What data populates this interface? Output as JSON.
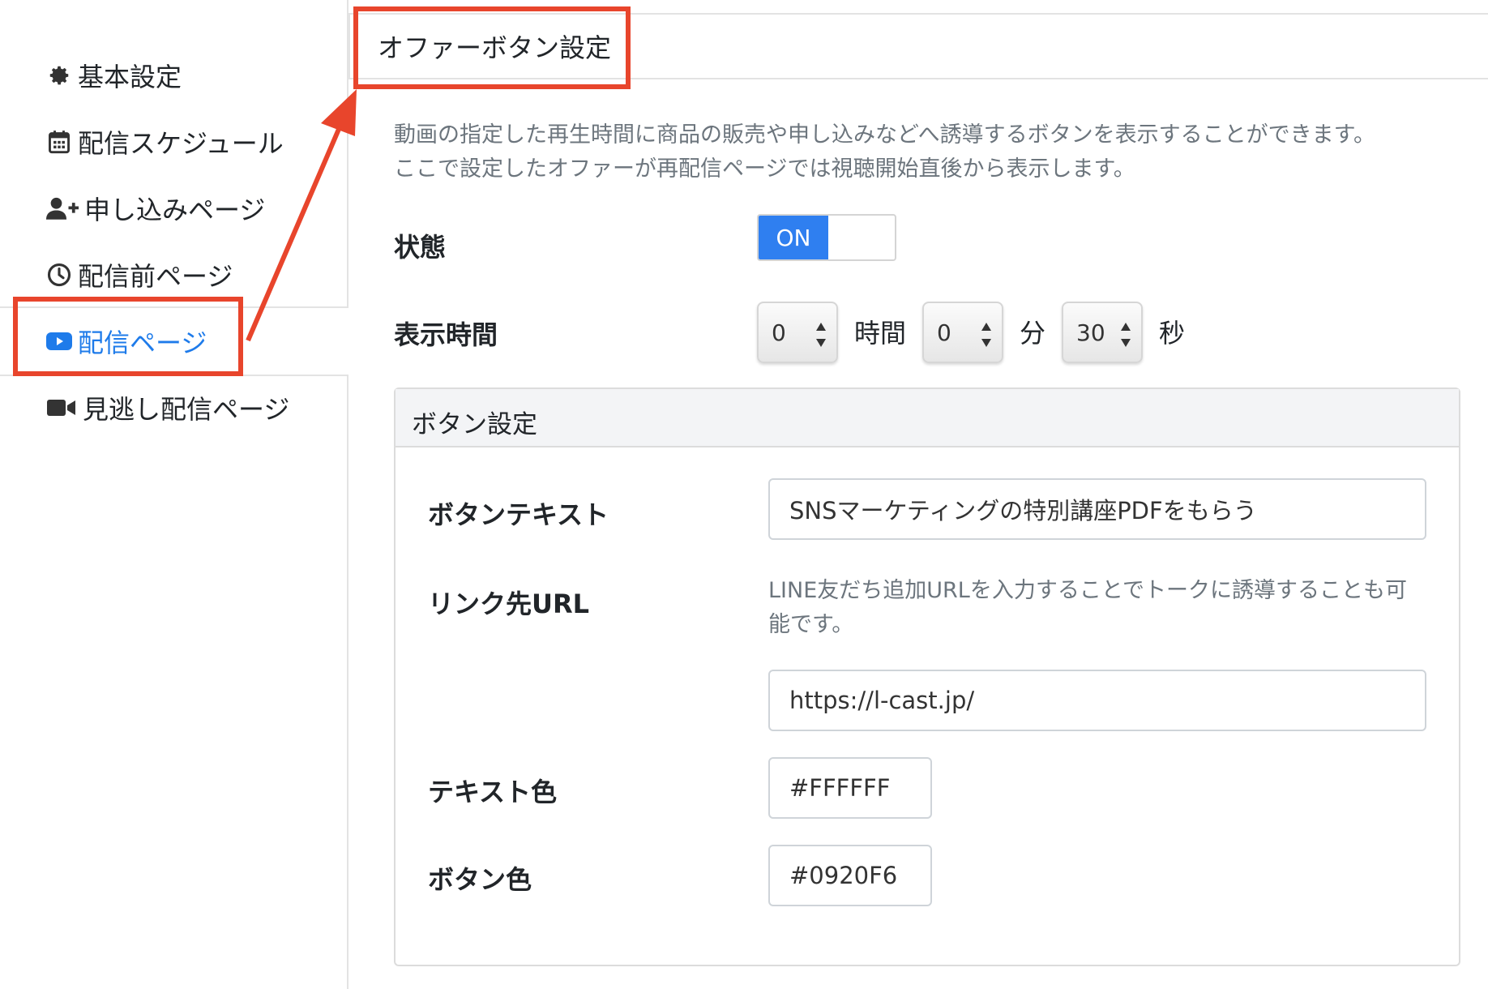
{
  "sidebar": {
    "items": [
      {
        "label": "基本設定",
        "icon": "gear-icon"
      },
      {
        "label": "配信スケジュール",
        "icon": "calendar-icon"
      },
      {
        "label": "申し込みページ",
        "icon": "user-plus-icon"
      },
      {
        "label": "配信前ページ",
        "icon": "clock-icon"
      },
      {
        "label": "配信ページ",
        "icon": "youtube-play-icon",
        "active": true
      },
      {
        "label": "見逃し配信ページ",
        "icon": "video-camera-icon"
      }
    ]
  },
  "header": {
    "title": "オファーボタン設定"
  },
  "description": {
    "line1": "動画の指定した再生時間に商品の販売や申し込みなどへ誘導するボタンを表示することができます。",
    "line2": "ここで設定したオファーが再配信ページでは視聴開始直後から表示します。"
  },
  "status": {
    "label": "状態",
    "toggle_text": "ON",
    "value": "on"
  },
  "display_time": {
    "label": "表示時間",
    "hours": "0",
    "hours_unit": "時間",
    "minutes": "0",
    "minutes_unit": "分",
    "seconds": "30",
    "seconds_unit": "秒"
  },
  "button_settings": {
    "title": "ボタン設定",
    "text_label": "ボタンテキスト",
    "text_value": "SNSマーケティングの特別講座PDFをもらう",
    "url_label": "リンク先URL",
    "url_help_line1": "LINE友だち追加URLを入力することでトークに誘導することも可",
    "url_help_line2": "能です。",
    "url_value": "https://l-cast.jp/",
    "text_color_label": "テキスト色",
    "text_color_value": "#FFFFFF",
    "button_color_label": "ボタン色",
    "button_color_value": "#0920F6"
  },
  "colors": {
    "accent": "#1e7bea",
    "annotation": "#e8452c",
    "toggle_on": "#2f7ff0"
  }
}
